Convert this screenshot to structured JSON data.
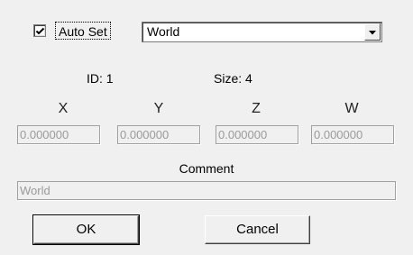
{
  "auto_set": {
    "label": "Auto Set",
    "checked": true
  },
  "combo": {
    "value": "World"
  },
  "info": {
    "id_label": "ID: 1",
    "size_label": "Size: 4"
  },
  "axes": {
    "x": {
      "label": "X",
      "value": "0.000000"
    },
    "y": {
      "label": "Y",
      "value": "0.000000"
    },
    "z": {
      "label": "Z",
      "value": "0.000000"
    },
    "w": {
      "label": "W",
      "value": "0.000000"
    }
  },
  "comment": {
    "label": "Comment",
    "value": "World"
  },
  "buttons": {
    "ok": "OK",
    "cancel": "Cancel"
  },
  "icons": {
    "checkbox": "checkmark-icon",
    "dropdown": "chevron-down-icon"
  }
}
